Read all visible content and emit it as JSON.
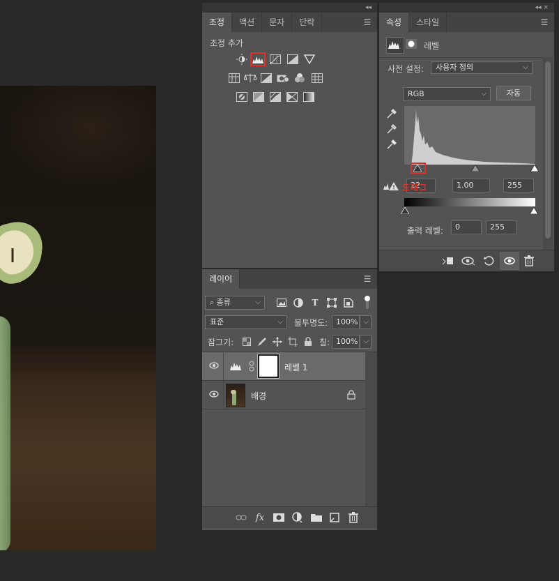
{
  "adjustments_panel": {
    "tabs": [
      {
        "label": "조정",
        "active": true
      },
      {
        "label": "액션",
        "active": false
      },
      {
        "label": "문자",
        "active": false
      },
      {
        "label": "단락",
        "active": false
      }
    ],
    "title": "조정 추가",
    "row1_icons": [
      "brightness-contrast-icon",
      "levels-icon",
      "curves-icon",
      "exposure-icon",
      "vibrance-icon"
    ],
    "row2_icons": [
      "hue-saturation-icon",
      "color-balance-icon",
      "black-white-icon",
      "photo-filter-icon",
      "channel-mixer-icon",
      "color-lookup-icon"
    ],
    "row3_icons": [
      "invert-icon",
      "posterize-icon",
      "threshold-icon",
      "selective-color-icon",
      "gradient-map-icon"
    ],
    "selected_icon": "levels-icon"
  },
  "properties_panel": {
    "tabs": [
      {
        "label": "속성",
        "active": true
      },
      {
        "label": "스타일",
        "active": false
      }
    ],
    "layer_type": "레벨",
    "preset_label": "사전 설정:",
    "preset_value": "사용자 정의",
    "channel_value": "RGB",
    "auto_label": "자동",
    "input_black": "22",
    "input_gamma": "1.00",
    "input_white": "255",
    "annotation": "드래그",
    "output_label": "출력 레벨:",
    "output_black": "0",
    "output_white": "255",
    "footer_icons": [
      "clip-to-layer-icon",
      "view-previous-icon",
      "reset-icon",
      "visibility-icon",
      "delete-icon"
    ]
  },
  "layers_panel": {
    "tab_label": "레이어",
    "filter_value": "종류",
    "blend_mode": "표준",
    "opacity_label": "불투명도:",
    "opacity_value": "100%",
    "lock_label": "잠그기:",
    "fill_label": "칠:",
    "fill_value": "100%",
    "layers": [
      {
        "name": "레벨 1",
        "selected": true,
        "type": "adjustment"
      },
      {
        "name": "배경",
        "selected": false,
        "type": "image",
        "locked": true
      }
    ],
    "footer_icons": [
      "link-icon",
      "fx-icon",
      "mask-icon",
      "adjustment-icon",
      "folder-icon",
      "new-layer-icon",
      "trash-icon"
    ]
  },
  "colors": {
    "panel_bg": "#535353",
    "highlight_red": "#e0302a"
  }
}
